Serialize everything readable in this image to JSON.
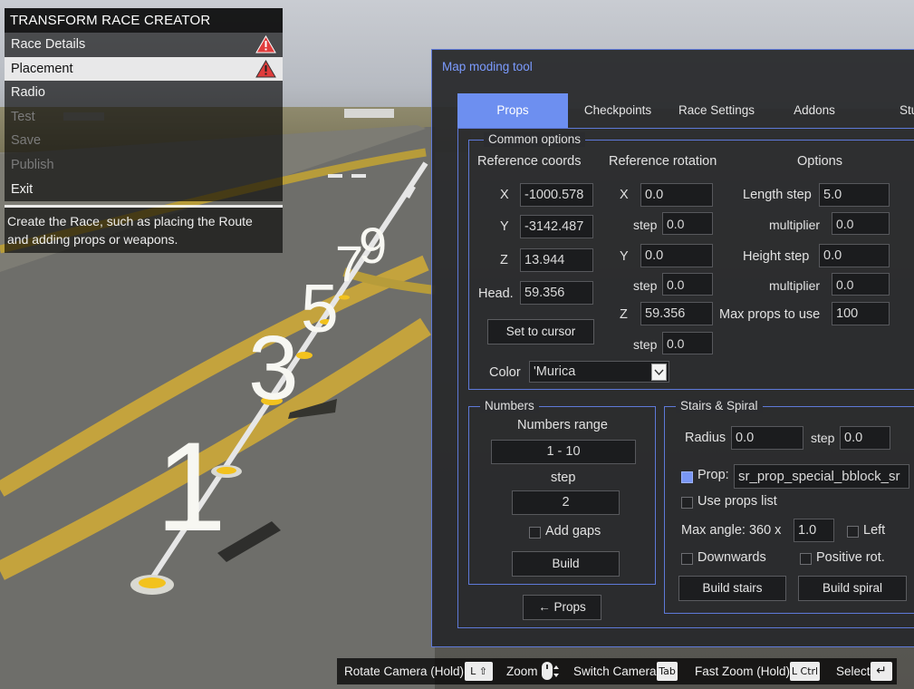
{
  "race_creator": {
    "title": "TRANSFORM RACE CREATOR",
    "items": [
      {
        "label": "Race Details",
        "state": "normal",
        "warning": true
      },
      {
        "label": "Placement",
        "state": "selected",
        "warning": true
      },
      {
        "label": "Radio",
        "state": "normal",
        "warning": false
      },
      {
        "label": "Test",
        "state": "disabled",
        "warning": false
      },
      {
        "label": "Save",
        "state": "disabled",
        "warning": false
      },
      {
        "label": "Publish",
        "state": "disabled",
        "warning": false
      },
      {
        "label": "Exit",
        "state": "normal",
        "warning": false
      }
    ],
    "description": "Create the Race, such as placing the Route and adding props or weapons."
  },
  "scene": {
    "numbers": [
      "1",
      "3",
      "5",
      "7",
      "9"
    ]
  },
  "tool": {
    "title": "Map moding tool",
    "tabs": [
      "Props",
      "Checkpoints",
      "Race Settings",
      "Addons",
      "Stu"
    ],
    "active_tab": "Props",
    "common": {
      "legend": "Common options",
      "ref_coords_heading": "Reference coords",
      "ref_rotation_heading": "Reference rotation",
      "options_heading": "Options",
      "coords": {
        "x_label": "X",
        "x": "-1000.578",
        "y_label": "Y",
        "y": "-3142.487",
        "z_label": "Z",
        "z": "13.944",
        "head_label": "Head.",
        "head": "59.356"
      },
      "set_to_cursor": "Set to cursor",
      "rotation": {
        "x_label": "X",
        "x": "0.0",
        "y_label": "Y",
        "y": "0.0",
        "z_label": "Z",
        "z": "59.356",
        "step_label": "step",
        "x_step": "0.0",
        "y_step": "0.0",
        "z_step": "0.0"
      },
      "options": {
        "length_step_label": "Length step",
        "length_step": "5.0",
        "multiplier_label": "multiplier",
        "length_multiplier": "0.0",
        "height_step_label": "Height step",
        "height_step": "0.0",
        "height_multiplier": "0.0",
        "max_props_label": "Max props to use",
        "max_props": "100"
      },
      "color_label": "Color",
      "color_value": "'Murica"
    },
    "numbers": {
      "legend": "Numbers",
      "range_label": "Numbers range",
      "range_value": "1 - 10",
      "step_label": "step",
      "step_value": "2",
      "add_gaps_label": "Add gaps",
      "add_gaps": false,
      "build_label": "Build"
    },
    "back_props_label": "← Props",
    "stairs": {
      "legend": "Stairs & Spiral",
      "radius_label": "Radius",
      "radius": "0.0",
      "step_label": "step",
      "radius_step": "0.0",
      "prop_label": "Prop:",
      "prop_checked": true,
      "prop_value": "sr_prop_special_bblock_sr",
      "use_props_list_label": "Use props list",
      "use_props_list": false,
      "max_angle_label": "Max angle: 360 x",
      "max_angle": "1.0",
      "left_label": "Left",
      "left": false,
      "downwards_label": "Downwards",
      "downwards": false,
      "positive_rot_label": "Positive rot.",
      "positive_rot": false,
      "build_stairs_label": "Build stairs",
      "build_spiral_label": "Build spiral"
    }
  },
  "hints": [
    {
      "label": "Rotate Camera (Hold)",
      "key": "L ⇧"
    },
    {
      "label": "Zoom",
      "key": "mouse-wheel"
    },
    {
      "label": "Switch Camera",
      "key": "Tab"
    },
    {
      "label": "Fast Zoom (Hold)",
      "key": "L Ctrl"
    },
    {
      "label": "Select",
      "key": "↵"
    }
  ],
  "colors": {
    "accent": "#6d8ff0",
    "title_accent": "#7b9bff",
    "warning": "#e03c3c",
    "panel_bg": "#2b2c2f"
  }
}
